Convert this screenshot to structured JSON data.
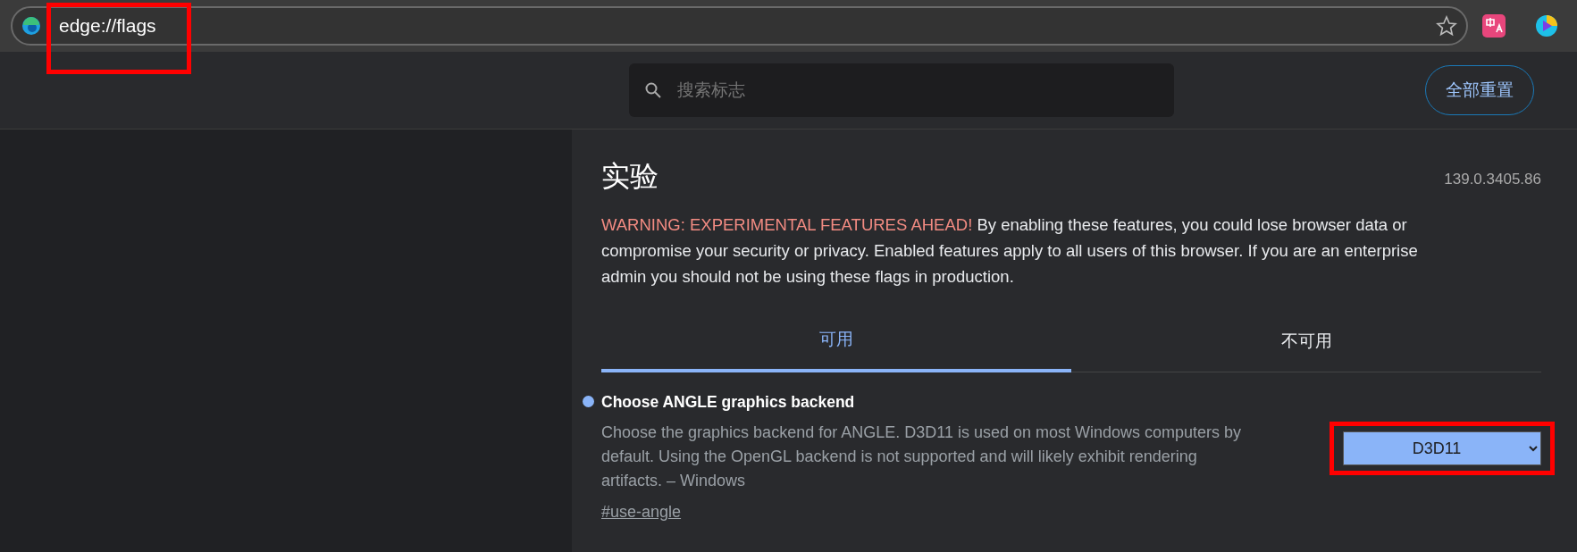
{
  "address_bar": {
    "url": "edge://flags",
    "highlighted": true
  },
  "header": {
    "search": {
      "placeholder": "搜索标志"
    },
    "reset_button": "全部重置"
  },
  "page": {
    "title": "实验",
    "version": "139.0.3405.86",
    "warning": {
      "label": "WARNING: EXPERIMENTAL FEATURES AHEAD!",
      "text": "By enabling these features, you could lose browser data or compromise your security or privacy. Enabled features apply to all users of this browser. If you are an enterprise admin you should not be using these flags in production."
    },
    "tabs": [
      {
        "label": "可用",
        "selected": true
      },
      {
        "label": "不可用",
        "selected": false
      }
    ],
    "flags": [
      {
        "title": "Choose ANGLE graphics backend",
        "modified": true,
        "description": "Choose the graphics backend for ANGLE. D3D11 is used on most Windows computers by default. Using the OpenGL backend is not supported and will likely exhibit rendering artifacts. – Windows",
        "link": "#use-angle",
        "value": "D3D11",
        "highlighted": true
      }
    ]
  }
}
